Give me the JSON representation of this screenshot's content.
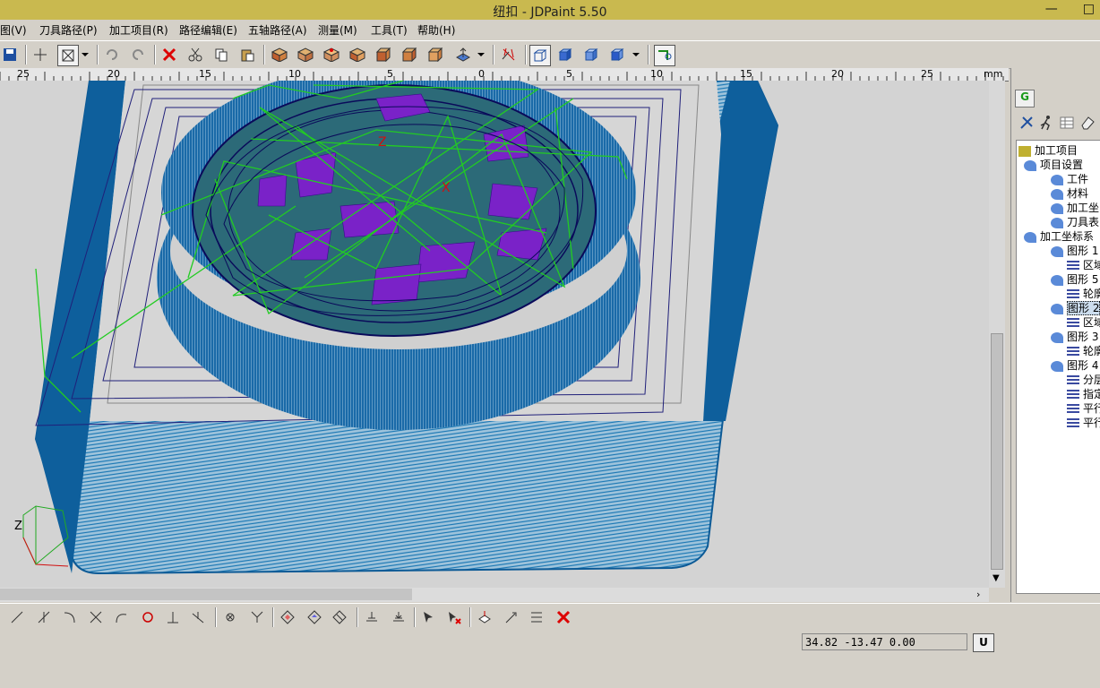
{
  "window": {
    "title": "纽扣 - JDPaint 5.50"
  },
  "menu": {
    "items": [
      "图(V)",
      "刀具路径(P)",
      "加工项目(R)",
      "路径编辑(E)",
      "五轴路径(A)",
      "测量(M)",
      "工具(T)",
      "帮助(H)"
    ]
  },
  "ruler": {
    "labels": [
      "25",
      "20",
      "15",
      "10",
      "5",
      "0",
      "5",
      "10",
      "15",
      "20",
      "25"
    ],
    "unit": "mm"
  },
  "panel": {
    "tab_label": "G",
    "tree": [
      {
        "label": "加工项目",
        "level": 0
      },
      {
        "label": "项目设置",
        "level": 1
      },
      {
        "label": "工件",
        "level": 2
      },
      {
        "label": "材料",
        "level": 2
      },
      {
        "label": "加工坐",
        "level": 2
      },
      {
        "label": "刀具表",
        "level": 2
      },
      {
        "label": "加工坐标系",
        "level": 1
      },
      {
        "label": "图形 1",
        "level": 2
      },
      {
        "label": "区域",
        "level": 3
      },
      {
        "label": "图形 5",
        "level": 2
      },
      {
        "label": "轮廓",
        "level": 3
      },
      {
        "label": "图形 2",
        "level": 2
      },
      {
        "label": "区域",
        "level": 3
      },
      {
        "label": "图形 3",
        "level": 2
      },
      {
        "label": "轮廓",
        "level": 3
      },
      {
        "label": "图形 4",
        "level": 2
      },
      {
        "label": "分层",
        "level": 3
      },
      {
        "label": "指定",
        "level": 3
      },
      {
        "label": "平行",
        "level": 3
      },
      {
        "label": "平行",
        "level": 3
      }
    ]
  },
  "status": {
    "coords": "34.82  -13.47  0.00",
    "unit_button": "U"
  },
  "axis": {
    "z_label": "Z"
  },
  "colors": {
    "toolpath_blue": "#0a64a0",
    "toolpath_green": "#22cc22",
    "titlebar": "#c9b94f"
  }
}
